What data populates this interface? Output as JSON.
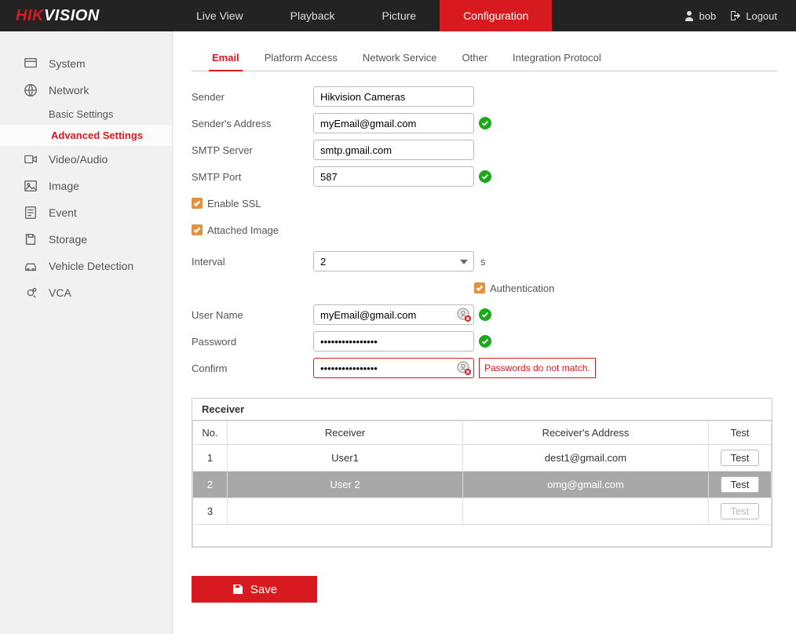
{
  "brand": {
    "hik": "HIK",
    "vision": "VISION"
  },
  "topnav": {
    "live": "Live View",
    "playback": "Playback",
    "picture": "Picture",
    "config": "Configuration"
  },
  "user": {
    "name": "bob",
    "logout": "Logout"
  },
  "sidebar": {
    "system": "System",
    "network": "Network",
    "basic": "Basic Settings",
    "advanced": "Advanced Settings",
    "videoaudio": "Video/Audio",
    "image": "Image",
    "event": "Event",
    "storage": "Storage",
    "vehicle": "Vehicle Detection",
    "vca": "VCA"
  },
  "tabs": {
    "email": "Email",
    "platform": "Platform Access",
    "netservice": "Network Service",
    "other": "Other",
    "integration": "Integration Protocol"
  },
  "form": {
    "sender_label": "Sender",
    "sender": "Hikvision Cameras",
    "sender_addr_label": "Sender's Address",
    "sender_addr": "myEmail@gmail.com",
    "smtp_label": "SMTP Server",
    "smtp": "smtp.gmail.com",
    "port_label": "SMTP Port",
    "port": "587",
    "enable_ssl": "Enable SSL",
    "attached_image": "Attached Image",
    "interval_label": "Interval",
    "interval_value": "2",
    "interval_unit": "s",
    "auth": "Authentication",
    "username_label": "User Name",
    "username": "myEmail@gmail.com",
    "password_label": "Password",
    "password": "••••••••••••••••",
    "confirm_label": "Confirm",
    "confirm": "••••••••••••••••",
    "error": "Passwords do not match."
  },
  "receiver": {
    "panel_title": "Receiver",
    "col_no": "No.",
    "col_recv": "Receiver",
    "col_addr": "Receiver's Address",
    "col_test": "Test",
    "test_label": "Test",
    "rows": [
      {
        "no": "1",
        "name": "User1",
        "addr": "dest1@gmail.com",
        "enabled": true,
        "selected": false
      },
      {
        "no": "2",
        "name": "User 2",
        "addr": "omg@gmail.com",
        "enabled": true,
        "selected": true
      },
      {
        "no": "3",
        "name": "",
        "addr": "",
        "enabled": false,
        "selected": false
      }
    ]
  },
  "save": "Save"
}
